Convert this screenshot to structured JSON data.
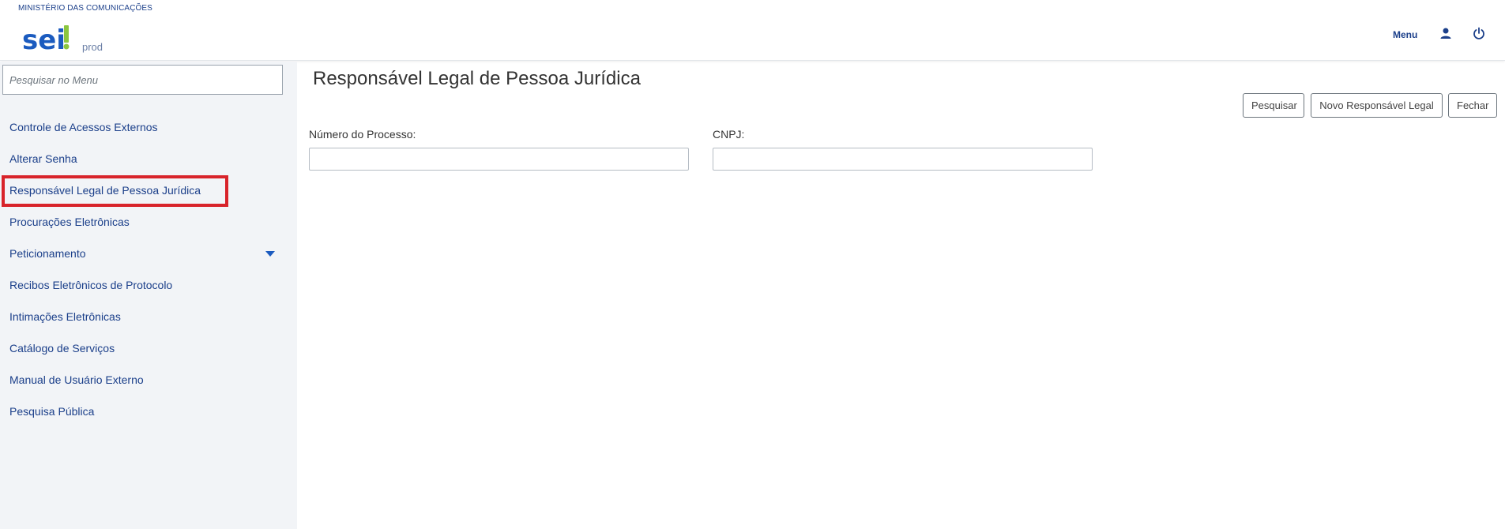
{
  "header": {
    "org_name": "MINISTÉRIO DAS COMUNICAÇÕES",
    "logo_text": "sei!",
    "environment": "prod",
    "menu_label": "Menu",
    "icons": [
      "user-icon",
      "power-icon"
    ],
    "brand_blue": "#1b5bbf",
    "brand_green": "#8cc63f"
  },
  "sidebar": {
    "search_placeholder": "Pesquisar no Menu",
    "items": [
      {
        "label": "Controle de Acessos Externos"
      },
      {
        "label": "Alterar Senha"
      },
      {
        "label": "Responsável Legal de Pessoa Jurídica",
        "highlighted": true
      },
      {
        "label": "Procurações Eletrônicas"
      },
      {
        "label": "Peticionamento",
        "has_submenu": true
      },
      {
        "label": "Recibos Eletrônicos de Protocolo"
      },
      {
        "label": "Intimações Eletrônicas"
      },
      {
        "label": "Catálogo de Serviços"
      },
      {
        "label": "Manual de Usuário Externo"
      },
      {
        "label": "Pesquisa Pública"
      }
    ],
    "highlight_color": "#d8232a"
  },
  "main": {
    "title": "Responsável Legal de Pessoa Jurídica",
    "buttons": {
      "pesquisar": "Pesquisar",
      "novo": "Novo Responsável Legal",
      "fechar": "Fechar"
    },
    "fields": {
      "processo_label": "Número do Processo:",
      "processo_value": "",
      "cnpj_label": "CNPJ:",
      "cnpj_value": ""
    }
  }
}
